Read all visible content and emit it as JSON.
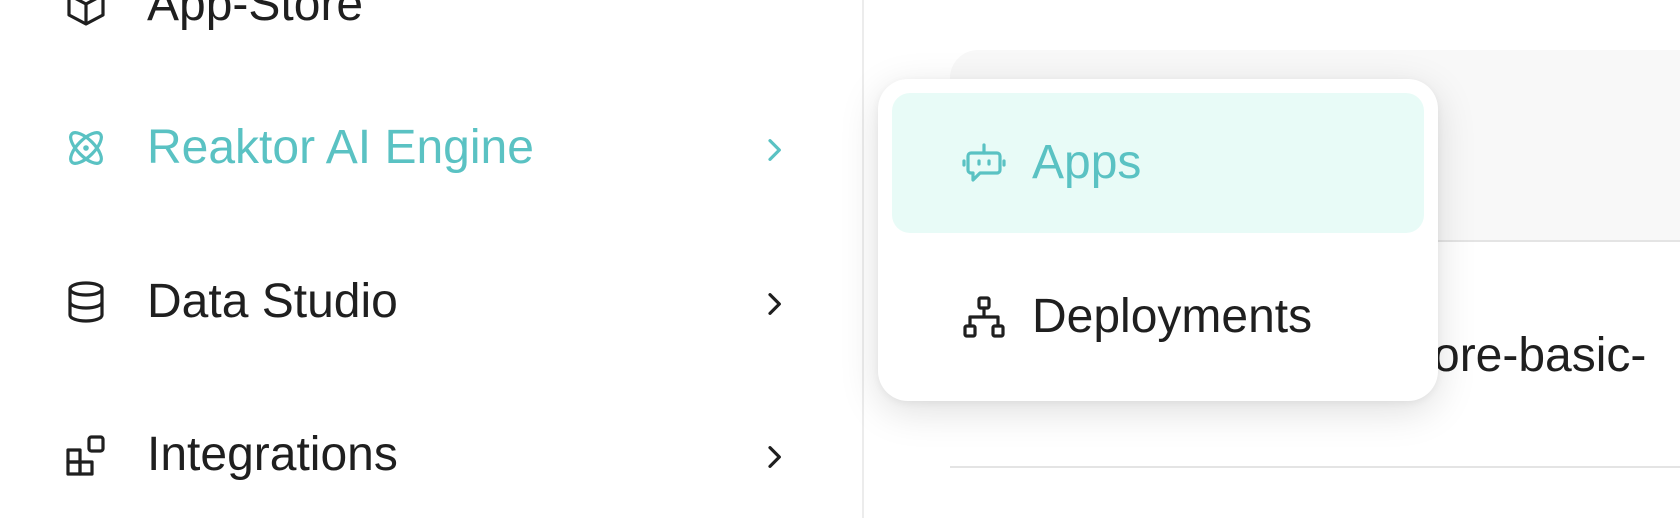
{
  "sidebar": {
    "items": [
      {
        "label": "App-Store",
        "icon": "cube-icon"
      },
      {
        "label": "Reaktor AI Engine",
        "icon": "atom-icon",
        "active": true
      },
      {
        "label": "Data Studio",
        "icon": "database-icon"
      },
      {
        "label": "Integrations",
        "icon": "blocks-icon"
      }
    ]
  },
  "submenu": {
    "items": [
      {
        "label": "Apps",
        "icon": "bot-icon",
        "selected": true
      },
      {
        "label": "Deployments",
        "icon": "network-icon"
      }
    ]
  },
  "content": {
    "row_text": "core-basic-"
  },
  "colors": {
    "accent": "#5ac2c3",
    "selected_background": "#e8fbf7",
    "text": "#1f1f1f"
  }
}
